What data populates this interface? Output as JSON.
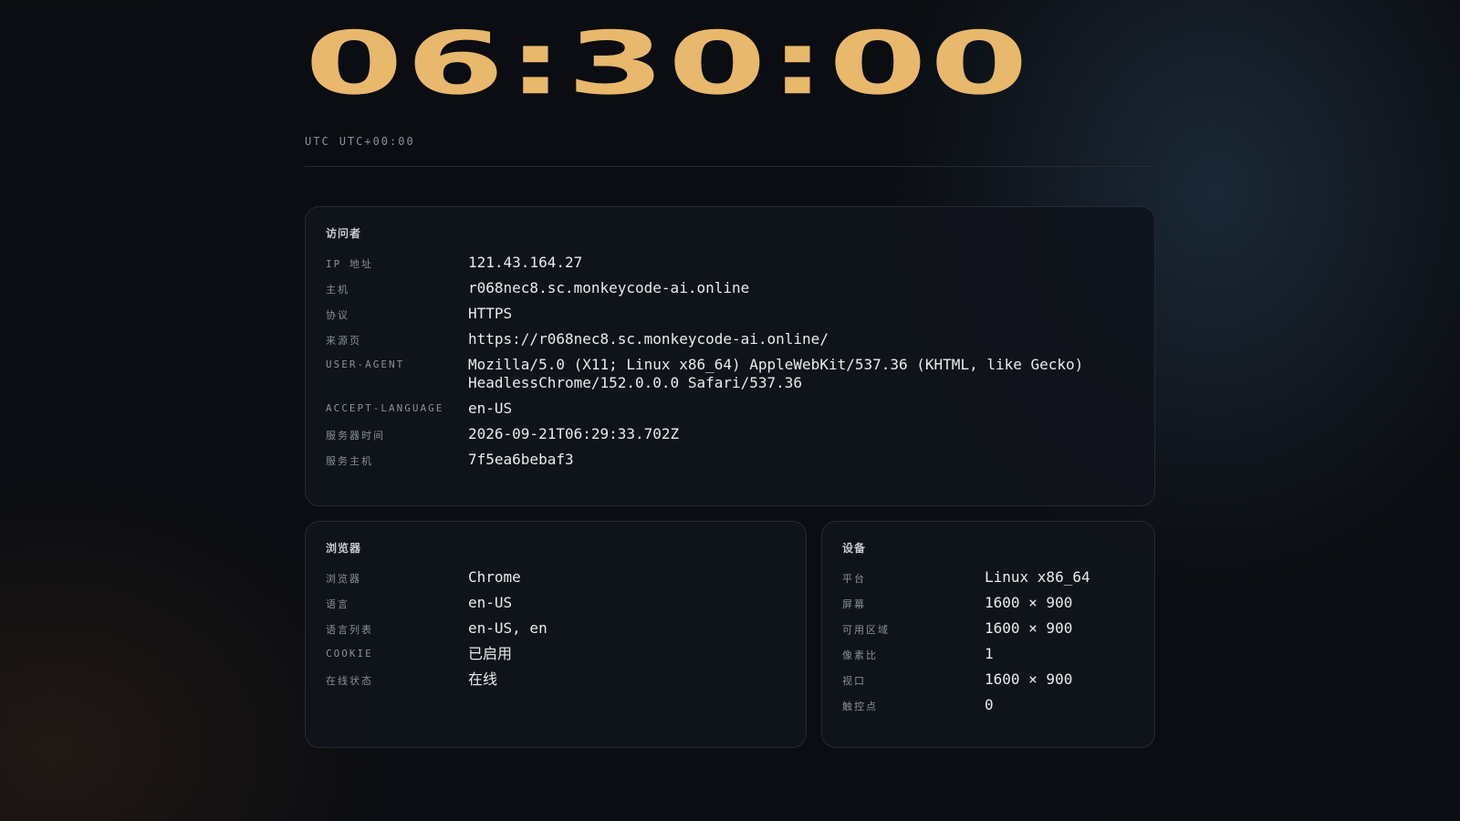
{
  "clock": {
    "time": "06:30:00",
    "tz_name": "UTC",
    "tz_offset": "UTC+00:00"
  },
  "visitor": {
    "title": "访问者",
    "rows": [
      {
        "key": "IP 地址",
        "value": "121.43.164.27"
      },
      {
        "key": "主机",
        "value": "r068nec8.sc.monkeycode-ai.online"
      },
      {
        "key": "协议",
        "value": "HTTPS"
      },
      {
        "key": "来源页",
        "value": "https://r068nec8.sc.monkeycode-ai.online/"
      },
      {
        "key": "USER-AGENT",
        "value": "Mozilla/5.0 (X11; Linux x86_64) AppleWebKit/537.36 (KHTML, like Gecko) HeadlessChrome/152.0.0.0 Safari/537.36"
      },
      {
        "key": "ACCEPT-LANGUAGE",
        "value": "en-US"
      },
      {
        "key": "服务器时间",
        "value": "2026-09-21T06:29:33.702Z"
      },
      {
        "key": "服务主机",
        "value": "7f5ea6bebaf3"
      }
    ]
  },
  "browser": {
    "title": "浏览器",
    "rows": [
      {
        "key": "浏览器",
        "value": "Chrome"
      },
      {
        "key": "语言",
        "value": "en-US"
      },
      {
        "key": "语言列表",
        "value": "en-US, en"
      },
      {
        "key": "COOKIE",
        "value": "已启用"
      },
      {
        "key": "在线状态",
        "value": "在线"
      }
    ]
  },
  "device": {
    "title": "设备",
    "rows": [
      {
        "key": "平台",
        "value": "Linux x86_64"
      },
      {
        "key": "屏幕",
        "value": "1600 × 900"
      },
      {
        "key": "可用区域",
        "value": "1600 × 900"
      },
      {
        "key": "像素比",
        "value": "1"
      },
      {
        "key": "视口",
        "value": "1600 × 900"
      },
      {
        "key": "触控点",
        "value": "0"
      }
    ]
  }
}
